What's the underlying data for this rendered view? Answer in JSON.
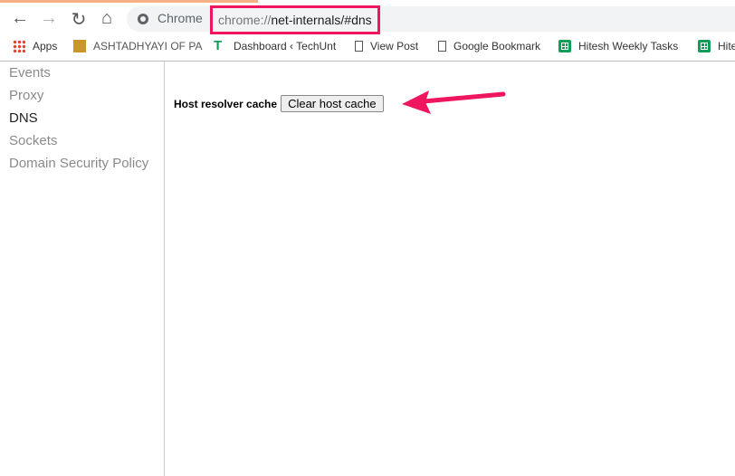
{
  "toolbar": {
    "chrome_label": "Chrome",
    "url_scheme": "chrome://",
    "url_rest": "net-internals/#dns"
  },
  "bookmarks": [
    {
      "label": "Apps",
      "icon": "apps-grid-icon"
    },
    {
      "label": "ASHTADHYAYI OF PA",
      "icon": "site-favicon"
    },
    {
      "label": "Dashboard ‹ TechUnt",
      "icon": "techunt-icon"
    },
    {
      "label": "View Post",
      "icon": "page-icon"
    },
    {
      "label": "Google Bookmark",
      "icon": "page-icon"
    },
    {
      "label": "Hitesh Weekly Tasks",
      "icon": "sheets-icon"
    },
    {
      "label": "Hite",
      "icon": "sheets-icon"
    }
  ],
  "sidebar": {
    "items": [
      {
        "label": "Events"
      },
      {
        "label": "Proxy"
      },
      {
        "label": "DNS",
        "active": true
      },
      {
        "label": "Sockets"
      },
      {
        "label": "Domain Security Policy"
      }
    ]
  },
  "main": {
    "label": "Host resolver cache",
    "button": "Clear host cache"
  },
  "colors": {
    "highlight": "#f0155f",
    "arrow": "#f0155f"
  }
}
